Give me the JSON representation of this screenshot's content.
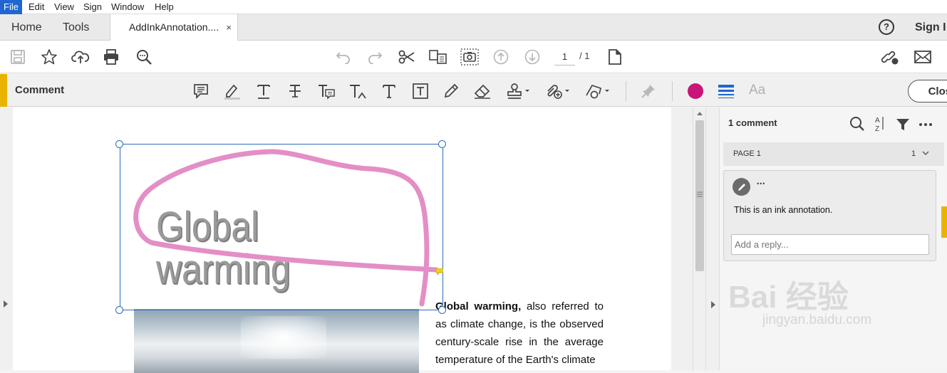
{
  "menu": {
    "items": [
      "File",
      "Edit",
      "View",
      "Sign",
      "Window",
      "Help"
    ]
  },
  "tabs": {
    "home": "Home",
    "tools": "Tools",
    "document": "AddInkAnnotation....",
    "close_glyph": "×"
  },
  "topright": {
    "help_glyph": "?",
    "sign_label": "Sign I"
  },
  "toolbar": {
    "page_current": "1",
    "page_total": "/ 1"
  },
  "comment_bar": {
    "title": "Comment",
    "close_label": "Close",
    "ink_color": "#c8157a",
    "text_style_label": "Aa"
  },
  "document": {
    "heading": "Global warming",
    "paragraph_lead": "Global warming,",
    "paragraph_rest": " also referred to as climate change, is the observed century-scale rise in the average temperature of the Earth's climate",
    "ink_color": "#e48ec6",
    "selection_color": "#2a6ebb"
  },
  "comments_panel": {
    "count": "1 comment",
    "page_label": "PAGE 1",
    "page_count": "1",
    "comment_text": "This is an ink annotation.",
    "reply_placeholder": "Add a reply...",
    "more_glyph": "•••"
  },
  "watermark": {
    "line1": "Bai 经验",
    "line2": "jingyan.baidu.com"
  }
}
